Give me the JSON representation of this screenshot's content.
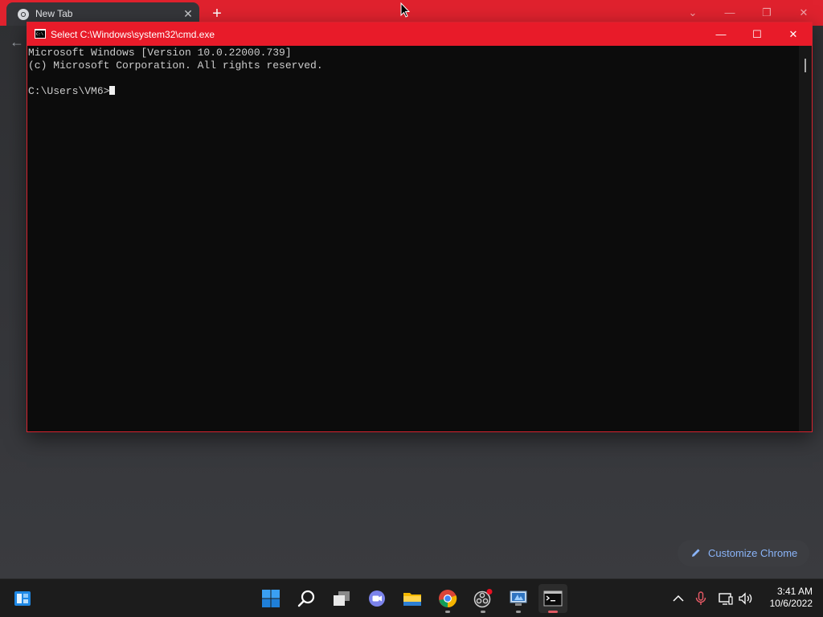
{
  "chrome": {
    "tab_title": "New Tab",
    "tab_close_glyph": "✕",
    "new_tab_glyph": "+",
    "back_glyph": "←",
    "window_controls": {
      "dropdown": "⌄",
      "minimize": "—",
      "restore": "❐",
      "close": "✕"
    },
    "customize_label": "Customize Chrome",
    "accent_color": "#e0222e"
  },
  "cmd": {
    "title": "Select C:\\Windows\\system32\\cmd.exe",
    "lines": [
      "Microsoft Windows [Version 10.0.22000.739]",
      "(c) Microsoft Corporation. All rights reserved.",
      "",
      "C:\\Users\\VM6>"
    ],
    "controls": {
      "minimize": "—",
      "maximize": "☐",
      "close": "✕"
    },
    "titlebar_color": "#e81b29"
  },
  "taskbar": {
    "items": [
      "start-icon",
      "search-icon",
      "task-view-icon",
      "teams-chat-icon",
      "file-explorer-icon",
      "chrome-icon",
      "obs-icon",
      "remote-desktop-icon",
      "terminal-icon"
    ],
    "tray": [
      "chevron-up-icon",
      "microphone-icon",
      "network-icon",
      "volume-icon"
    ],
    "time": "3:41 AM",
    "date": "10/6/2022"
  }
}
